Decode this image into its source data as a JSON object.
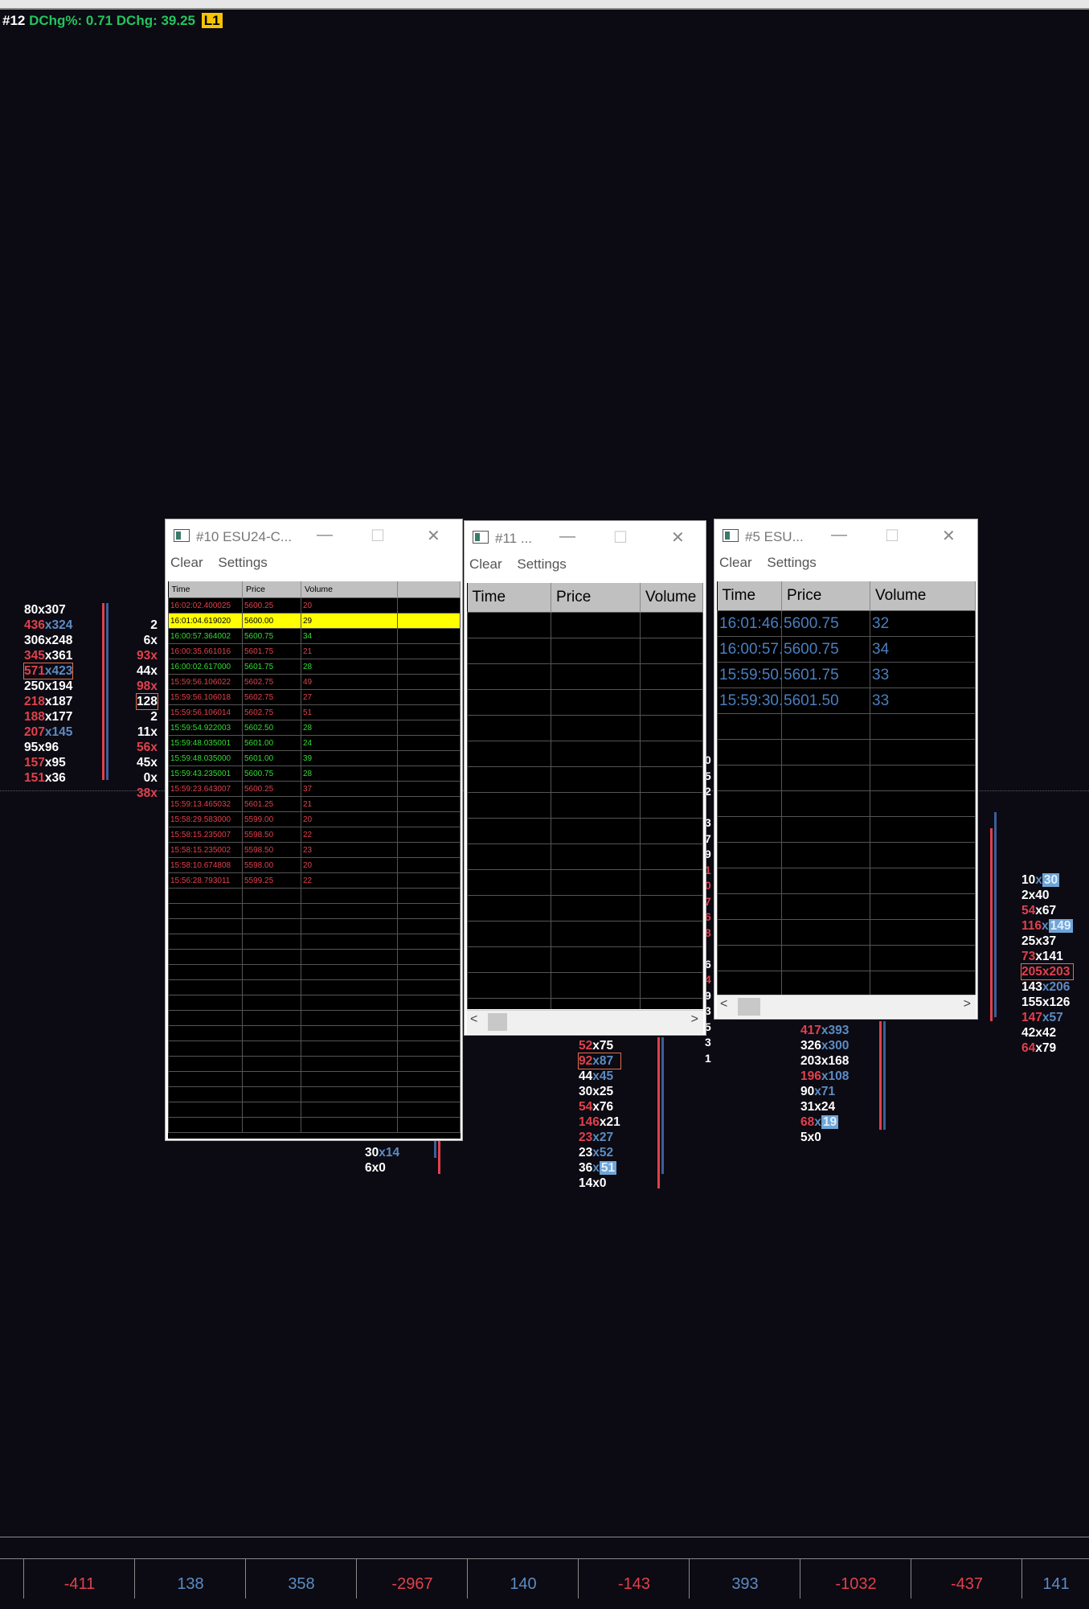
{
  "header": {
    "id": "#12",
    "dchg_pct": "DChg%: 0.71",
    "dchg": "DChg: 39.25",
    "badge": "L1"
  },
  "left_ladder": [
    [
      [
        "w",
        "80"
      ],
      [
        "w",
        "x"
      ],
      [
        "w",
        "307"
      ]
    ],
    [
      [
        "r",
        "436"
      ],
      [
        "b",
        "x"
      ],
      [
        "b",
        "324"
      ]
    ],
    [
      [
        "w",
        "306"
      ],
      [
        "w",
        "x"
      ],
      [
        "w",
        "248"
      ]
    ],
    [
      [
        "r",
        "345"
      ],
      [
        "w",
        "x"
      ],
      [
        "w",
        "361"
      ]
    ],
    [
      [
        "r",
        "571"
      ],
      [
        "b",
        "x"
      ],
      [
        "b",
        "423"
      ]
    ],
    [
      [
        "w",
        "250"
      ],
      [
        "w",
        "x"
      ],
      [
        "w",
        "194"
      ]
    ],
    [
      [
        "r",
        "218"
      ],
      [
        "w",
        "x"
      ],
      [
        "w",
        "187"
      ]
    ],
    [
      [
        "r",
        "188"
      ],
      [
        "w",
        "x"
      ],
      [
        "w",
        "177"
      ]
    ],
    [
      [
        "r",
        "207"
      ],
      [
        "b",
        "x"
      ],
      [
        "b",
        "145"
      ]
    ],
    [
      [
        "w",
        "95"
      ],
      [
        "w",
        "x"
      ],
      [
        "w",
        "96"
      ]
    ],
    [
      [
        "r",
        "157"
      ],
      [
        "w",
        "x"
      ],
      [
        "w",
        "95"
      ]
    ],
    [
      [
        "r",
        "151"
      ],
      [
        "w",
        "x"
      ],
      [
        "w",
        "36"
      ]
    ]
  ],
  "left_ladder2": [
    "2",
    "6x",
    "93x",
    "44x",
    "98x",
    "128",
    "2",
    "11x",
    "56x",
    "45x",
    "0x",
    "38x"
  ],
  "left_ladder2_colors": [
    "w",
    "w",
    "r",
    "w",
    "r",
    "w",
    "w",
    "w",
    "r",
    "w",
    "w",
    "r"
  ],
  "mid_ladder_a": [
    [
      [
        "w",
        "30"
      ],
      [
        "b",
        "x"
      ],
      [
        "b",
        "14"
      ]
    ],
    [
      [
        "w",
        "6"
      ],
      [
        "w",
        "x"
      ],
      [
        "w",
        "0"
      ]
    ]
  ],
  "mid_ladder_b": [
    [
      [
        "r",
        "52"
      ],
      [
        "w",
        "x"
      ],
      [
        "w",
        "75"
      ]
    ],
    [
      [
        "r",
        "92"
      ],
      [
        "b",
        "x"
      ],
      [
        "b",
        "87"
      ]
    ],
    [
      [
        "w",
        "44"
      ],
      [
        "b",
        "x"
      ],
      [
        "b",
        "45"
      ]
    ],
    [
      [
        "w",
        "30"
      ],
      [
        "w",
        "x"
      ],
      [
        "w",
        "25"
      ]
    ],
    [
      [
        "r",
        "54"
      ],
      [
        "w",
        "x"
      ],
      [
        "w",
        "76"
      ]
    ],
    [
      [
        "r",
        "146"
      ],
      [
        "w",
        "x"
      ],
      [
        "w",
        "21"
      ]
    ],
    [
      [
        "r",
        "23"
      ],
      [
        "b",
        "x"
      ],
      [
        "b",
        "27"
      ]
    ],
    [
      [
        "w",
        "23"
      ],
      [
        "b",
        "x"
      ],
      [
        "b",
        "52"
      ]
    ],
    [
      [
        "w",
        "36"
      ],
      [
        "b",
        "x"
      ],
      [
        "b",
        "51"
      ]
    ],
    [
      [
        "w",
        "14"
      ],
      [
        "w",
        "x"
      ],
      [
        "w",
        "0"
      ]
    ]
  ],
  "mid_ladder_c": [
    [
      [
        "r",
        "417"
      ],
      [
        "b",
        "x"
      ],
      [
        "b",
        "393"
      ]
    ],
    [
      [
        "w",
        "326"
      ],
      [
        "b",
        "x"
      ],
      [
        "b",
        "300"
      ]
    ],
    [
      [
        "w",
        "203"
      ],
      [
        "w",
        "x"
      ],
      [
        "w",
        "168"
      ]
    ],
    [
      [
        "r",
        "196"
      ],
      [
        "b",
        "x"
      ],
      [
        "b",
        "108"
      ]
    ],
    [
      [
        "w",
        "90"
      ],
      [
        "b",
        "x"
      ],
      [
        "b",
        "71"
      ]
    ],
    [
      [
        "w",
        "31"
      ],
      [
        "w",
        "x"
      ],
      [
        "w",
        "24"
      ]
    ],
    [
      [
        "r",
        "68"
      ],
      [
        "b",
        "x"
      ],
      [
        "b",
        "19"
      ]
    ],
    [
      [
        "w",
        "5"
      ],
      [
        "w",
        "x"
      ],
      [
        "w",
        "0"
      ]
    ]
  ],
  "right_ladder": [
    [
      [
        "w",
        "10"
      ],
      [
        "b",
        "x"
      ],
      [
        "b",
        "30"
      ]
    ],
    [
      [
        "w",
        "2"
      ],
      [
        "w",
        "x"
      ],
      [
        "w",
        "40"
      ]
    ],
    [
      [
        "r",
        "54"
      ],
      [
        "w",
        "x"
      ],
      [
        "w",
        "67"
      ]
    ],
    [
      [
        "r",
        "116"
      ],
      [
        "b",
        "x"
      ],
      [
        "b",
        "149"
      ]
    ],
    [
      [
        "w",
        "25"
      ],
      [
        "w",
        "x"
      ],
      [
        "w",
        "37"
      ]
    ],
    [
      [
        "r",
        "73"
      ],
      [
        "w",
        "x"
      ],
      [
        "w",
        "141"
      ]
    ],
    [
      [
        "r",
        "205"
      ],
      [
        "r",
        "x"
      ],
      [
        "r",
        "203"
      ]
    ],
    [
      [
        "w",
        "143"
      ],
      [
        "b",
        "x"
      ],
      [
        "b",
        "206"
      ]
    ],
    [
      [
        "w",
        "155"
      ],
      [
        "w",
        "x"
      ],
      [
        "w",
        "126"
      ]
    ],
    [
      [
        "r",
        "147"
      ],
      [
        "b",
        "x"
      ],
      [
        "b",
        "57"
      ]
    ],
    [
      [
        "w",
        "42"
      ],
      [
        "w",
        "x"
      ],
      [
        "w",
        "42"
      ]
    ],
    [
      [
        "r",
        "64"
      ],
      [
        "w",
        "x"
      ],
      [
        "w",
        "79"
      ]
    ]
  ],
  "partial_digits": [
    "0",
    "5",
    "2",
    "",
    "3",
    "7",
    "9",
    "1",
    "0",
    "7",
    "6",
    "8",
    "",
    "6",
    "4",
    "9",
    "3",
    "5",
    "3",
    "1"
  ],
  "bottom_values": [
    "-411",
    "138",
    "358",
    "-2967",
    "140",
    "-143",
    "393",
    "-1032",
    "-437",
    "141"
  ],
  "bottom_colors": [
    "#e0414d",
    "#5b8cc4",
    "#5b8cc4",
    "#e0414d",
    "#5b8cc4",
    "#e0414d",
    "#5b8cc4",
    "#e0414d",
    "#e0414d",
    "#5b8cc4"
  ],
  "colors": {
    "red": "#e0414d",
    "blue": "#5b8cc4",
    "green": "#22c55e",
    "yellow": "#ffff00",
    "bg": "#0c0a12"
  },
  "win10": {
    "title": "#10 ESU24-C...",
    "menu": {
      "clear": "Clear",
      "settings": "Settings"
    },
    "columns": [
      "Time",
      "Price",
      "Volume",
      ""
    ],
    "rows": [
      {
        "time": "16:02:02.400025",
        "price": "5600.25",
        "volume": "20",
        "color": "red"
      },
      {
        "time": "16:01:04.619020",
        "price": "5600.00",
        "volume": "29",
        "color": "highlight"
      },
      {
        "time": "16:00:57.364002",
        "price": "5600.75",
        "volume": "34",
        "color": "green"
      },
      {
        "time": "16:00:35.661016",
        "price": "5601.75",
        "volume": "21",
        "color": "red"
      },
      {
        "time": "16:00:02.617000",
        "price": "5601.75",
        "volume": "28",
        "color": "green"
      },
      {
        "time": "15:59:56.106022",
        "price": "5602.75",
        "volume": "49",
        "color": "red"
      },
      {
        "time": "15:59:56.106018",
        "price": "5602.75",
        "volume": "27",
        "color": "red"
      },
      {
        "time": "15:59:56.106014",
        "price": "5602.75",
        "volume": "51",
        "color": "red"
      },
      {
        "time": "15:59:54.922003",
        "price": "5602.50",
        "volume": "28",
        "color": "green"
      },
      {
        "time": "15:59:48.035001",
        "price": "5601.00",
        "volume": "24",
        "color": "green"
      },
      {
        "time": "15:59:48.035000",
        "price": "5601.00",
        "volume": "39",
        "color": "green"
      },
      {
        "time": "15:59:43.235001",
        "price": "5600.75",
        "volume": "28",
        "color": "green"
      },
      {
        "time": "15:59:23.643007",
        "price": "5600.25",
        "volume": "37",
        "color": "red"
      },
      {
        "time": "15:59:13.465032",
        "price": "5601.25",
        "volume": "21",
        "color": "red"
      },
      {
        "time": "15:58:29.583000",
        "price": "5599.00",
        "volume": "20",
        "color": "red"
      },
      {
        "time": "15:58:15.235007",
        "price": "5598.50",
        "volume": "22",
        "color": "red"
      },
      {
        "time": "15:58:15.235002",
        "price": "5598.50",
        "volume": "23",
        "color": "red"
      },
      {
        "time": "15:58:10.674808",
        "price": "5598.00",
        "volume": "20",
        "color": "red"
      },
      {
        "time": "15:56:28.793011",
        "price": "5599.25",
        "volume": "22",
        "color": "red"
      }
    ]
  },
  "win11": {
    "title": "#11 ...",
    "menu": {
      "clear": "Clear",
      "settings": "Settings"
    },
    "columns": [
      "Time",
      "Price",
      "Volume"
    ]
  },
  "win5": {
    "title": "#5 ESU...",
    "menu": {
      "clear": "Clear",
      "settings": "Settings"
    },
    "columns": [
      "Time",
      "Price",
      "Volume"
    ],
    "rows": [
      {
        "time": "16:01:46.",
        "price": "5600.75",
        "volume": "32"
      },
      {
        "time": "16:00:57.",
        "price": "5600.75",
        "volume": "34"
      },
      {
        "time": "15:59:50.",
        "price": "5601.75",
        "volume": "33"
      },
      {
        "time": "15:59:30.",
        "price": "5601.50",
        "volume": "33"
      }
    ]
  }
}
